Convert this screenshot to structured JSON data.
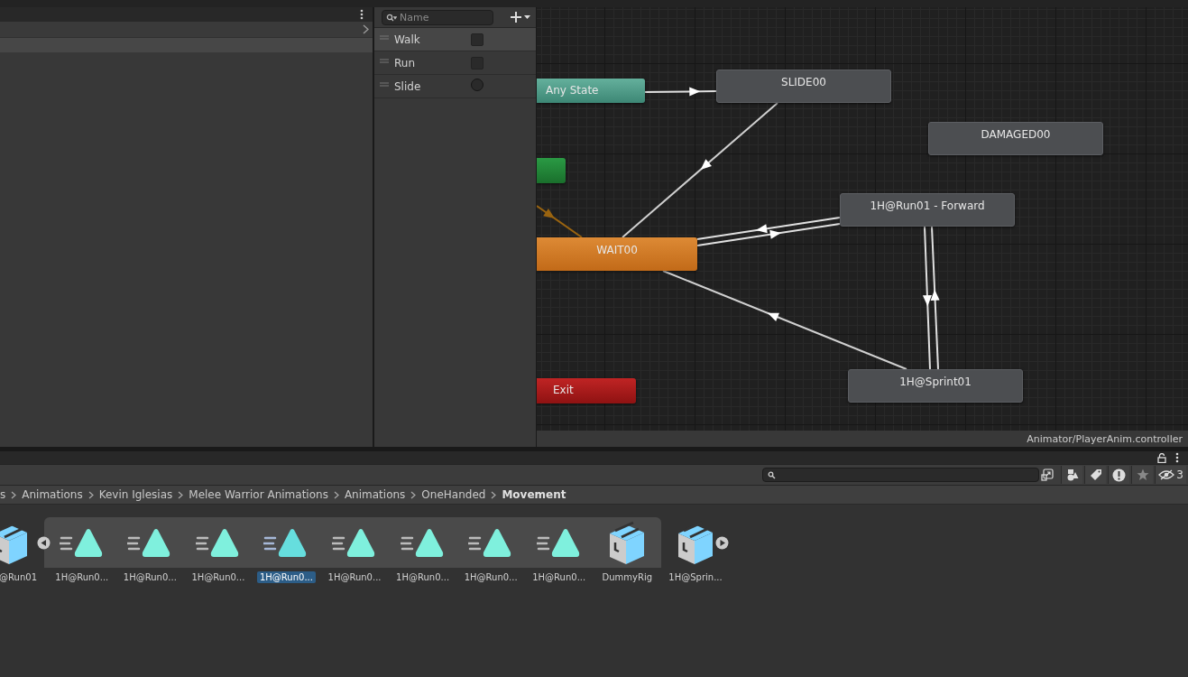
{
  "parameters": {
    "search_placeholder": "Name",
    "items": [
      {
        "name": "Walk",
        "kind": "bool",
        "checked": false,
        "selected": true
      },
      {
        "name": "Run",
        "kind": "bool",
        "checked": false,
        "selected": false
      },
      {
        "name": "Slide",
        "kind": "trigger",
        "checked": false,
        "selected": false
      }
    ]
  },
  "graph": {
    "states": [
      {
        "label": "Any State",
        "kind": "any"
      },
      {
        "label": "SLIDE00",
        "kind": "state"
      },
      {
        "label": "DAMAGED00",
        "kind": "state"
      },
      {
        "kind": "entry"
      },
      {
        "label": "1H@Run01 - Forward",
        "kind": "state"
      },
      {
        "label": "WAIT00",
        "kind": "default"
      },
      {
        "label": "Exit",
        "kind": "exit"
      },
      {
        "label": "1H@Sprint01",
        "kind": "state"
      }
    ],
    "status": "Animator/PlayerAnim.controller"
  },
  "project": {
    "hidden_count": "3",
    "breadcrumb": [
      {
        "label": "s",
        "selected": false
      },
      {
        "label": "Animations",
        "selected": false
      },
      {
        "label": "Kevin Iglesias",
        "selected": false
      },
      {
        "label": "Melee Warrior Animations",
        "selected": false
      },
      {
        "label": "Animations",
        "selected": false
      },
      {
        "label": "OneHanded",
        "selected": false
      },
      {
        "label": "Movement",
        "selected": true
      }
    ],
    "assets": [
      {
        "label": "@Run01",
        "kind": "model",
        "selected": false
      },
      {
        "label": "1H@Run0...",
        "kind": "clip",
        "selected": false
      },
      {
        "label": "1H@Run0...",
        "kind": "clip",
        "selected": false
      },
      {
        "label": "1H@Run0...",
        "kind": "clip",
        "selected": false
      },
      {
        "label": "1H@Run0...",
        "kind": "clip",
        "selected": true
      },
      {
        "label": "1H@Run0...",
        "kind": "clip",
        "selected": false
      },
      {
        "label": "1H@Run0...",
        "kind": "clip",
        "selected": false
      },
      {
        "label": "1H@Run0...",
        "kind": "clip",
        "selected": false
      },
      {
        "label": "1H@Run0...",
        "kind": "clip",
        "selected": false
      },
      {
        "label": "DummyRig",
        "kind": "model",
        "selected": false
      },
      {
        "label": "1H@Sprin...",
        "kind": "model",
        "selected": false
      }
    ]
  }
}
